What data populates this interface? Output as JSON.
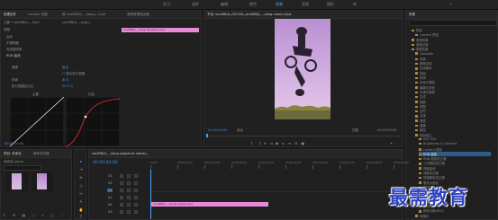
{
  "workspaces": [
    "学习",
    "组件",
    "编辑",
    "颜色",
    "效果",
    "音频",
    "图形",
    "库"
  ],
  "effect_controls": {
    "tabs": [
      "效果控件",
      "Lumetri 范围",
      "源: sm/WB/d_...(long)...mp4",
      "音频剪辑混合器"
    ],
    "source_label": "主要 * sm/WB/d_...mp4",
    "seq_label": "sm/WB/d_...(seq)...",
    "rows": [
      "视频",
      "运动",
      "不透明度",
      "时间重映射",
      "RGB 曲线",
      "通道",
      "显示拆分视图",
      "布局",
      "拆分视图百分比",
      "主要"
    ],
    "channel_value": "复合",
    "layout_value": "水平",
    "percent_value": "50.0 %",
    "curve_labels": [
      "主要",
      "红色"
    ],
    "bottom_labels": [
      "绿色",
      "蓝色"
    ],
    "timecode": "00:00:00:00"
  },
  "timeline_clip_label": "sm/WB/d_...long filename.mp4",
  "program": {
    "title": "节目: sm/WB/d_2023/0s_sm/WB/d_...(long name).mp4",
    "timecode_left": "00:00:00:00",
    "fit": "适合",
    "quality": "完整",
    "timecode_right": "00:00:09:00"
  },
  "project": {
    "tabs": [
      "项目: 未命名",
      "媒体浏览器"
    ],
    "path": "未命名.prproj",
    "search_placeholder": ""
  },
  "timeline": {
    "title": "sm/WB/d_...(long sequence name)...",
    "timecode": "00:00:00:00",
    "ruler": [
      "00:00",
      "00:00:01:00",
      "00:00:02:00",
      "00:00:03:00",
      "00:00:04:00",
      "00:00:05:00",
      "00:00:06:00",
      "00:00:07:00",
      "00:00:08:00",
      "00:00:09:00"
    ],
    "tracks": [
      "V3",
      "V2",
      "V1",
      "A1",
      "A2",
      "A3"
    ],
    "clip_label": "sm/WB/d_...(long name).mp4"
  },
  "effects_panel": {
    "title": "效果",
    "items": [
      "预设",
      "Lumetri 预设",
      "音频效果",
      "音频过渡",
      "视频效果",
      "Obsolete",
      "变换",
      "图像控制",
      "实用程序",
      "扭曲",
      "时间",
      "杂色与颗粒",
      "模糊与锐化",
      "沉浸式视频",
      "生成",
      "视频",
      "调整",
      "过时",
      "过渡",
      "透视",
      "通道",
      "键控",
      "颜色校正",
      "ASC CDL",
      "Brightness & Contrast",
      "Lumetri 颜色",
      "RGB 曲线",
      "RGB 颜色校正器",
      "三向颜色校正器",
      "亮度曲线",
      "亮度校正器",
      "快速颜色校正器",
      "更改为颜色",
      "更改颜色",
      "色彩",
      "视频限幅器(旧版)",
      "通道混合器",
      "颜色平衡",
      "颜色平衡(HLS)",
      "风格化",
      "视频过渡"
    ],
    "selected_index": 26
  },
  "watermark": "最需教育",
  "colors": {
    "accent": "#4aa3ff",
    "clip": "#e98ad6",
    "sky": "#c9a0d6",
    "folder": "#b08a3a"
  }
}
